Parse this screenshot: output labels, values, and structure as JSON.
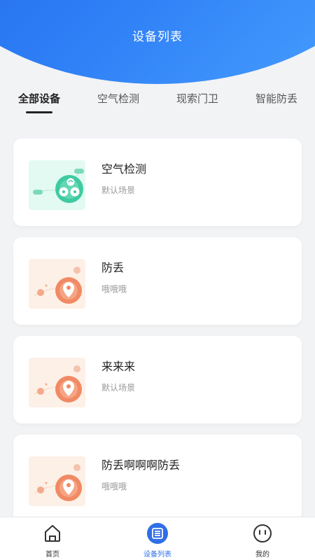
{
  "header": {
    "title": "设备列表"
  },
  "tabs": [
    {
      "label": "全部设备",
      "active": true
    },
    {
      "label": "空气检测",
      "active": false
    },
    {
      "label": "现索门卫",
      "active": false
    },
    {
      "label": "智能防丢",
      "active": false
    }
  ],
  "devices": [
    {
      "name": "空气检测",
      "scene": "默认场景",
      "icon": "air-monitor-illustration"
    },
    {
      "name": "防丢",
      "scene": "哦哦哦",
      "icon": "location-pin-illustration"
    },
    {
      "name": "来来来",
      "scene": "默认场景",
      "icon": "location-pin-illustration"
    },
    {
      "name": "防丢啊啊啊防丢",
      "scene": "哦哦哦",
      "icon": "location-pin-illustration"
    }
  ],
  "tabbar": [
    {
      "label": "首页",
      "icon": "home-icon",
      "active": false
    },
    {
      "label": "设备列表",
      "icon": "list-icon",
      "active": true
    },
    {
      "label": "我的",
      "icon": "face-icon",
      "active": false
    }
  ],
  "colors": {
    "primary": "#2f6fe6",
    "background": "#f2f3f5",
    "air_thumb": "#e2faf2",
    "pin_thumb": "#fdf0e6"
  }
}
